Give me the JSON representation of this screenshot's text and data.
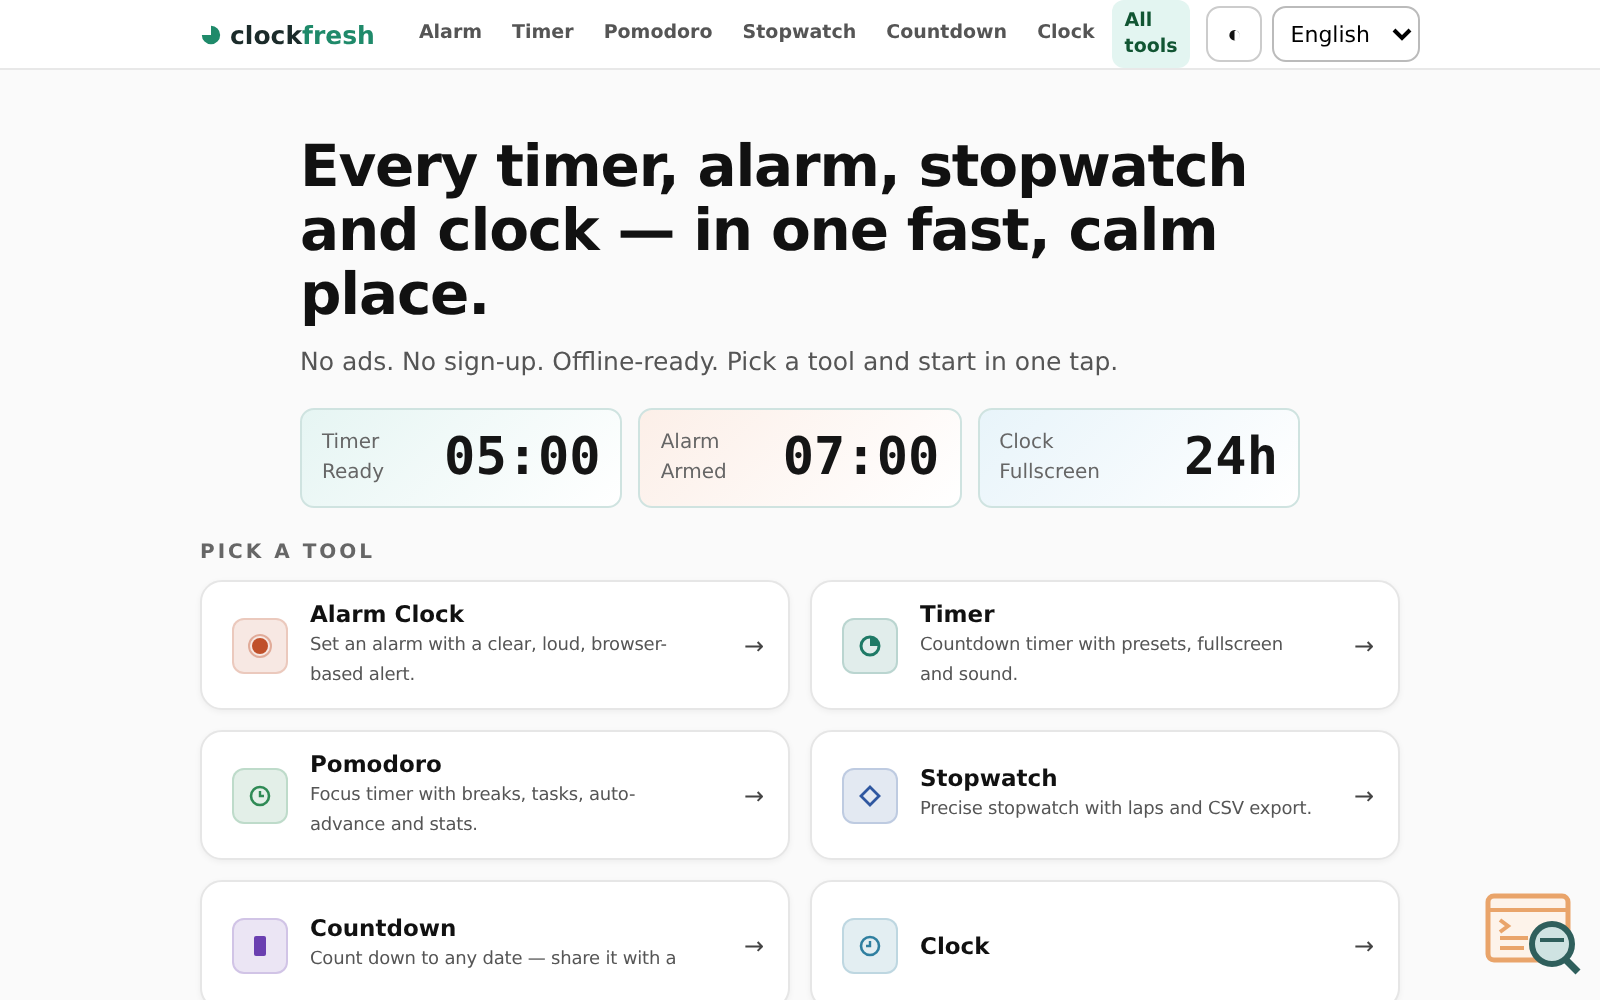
{
  "header": {
    "logo": {
      "brand": "clock",
      "accent": "fresh"
    },
    "nav": [
      {
        "label": "Alarm",
        "selected": false
      },
      {
        "label": "Timer",
        "selected": false
      },
      {
        "label": "Pomodoro",
        "selected": false
      },
      {
        "label": "Stopwatch",
        "selected": false
      },
      {
        "label": "Countdown",
        "selected": false
      },
      {
        "label": "Clock",
        "selected": false
      },
      {
        "label": "All tools",
        "selected": true
      }
    ],
    "theme_toggle": "◐",
    "language": {
      "value": "English"
    }
  },
  "hero": {
    "headline": "Every timer, alarm, stopwatch and clock — in one fast, calm place.",
    "subtitle": "No ads. No sign-up. Offline-ready. Pick a tool and start in one tap.",
    "stats": [
      {
        "label": "Timer",
        "status": "Ready",
        "value": "05:00",
        "color": "#e6f5f3"
      },
      {
        "label": "Alarm",
        "status": "Armed",
        "value": "07:00",
        "color": "#fcefe8"
      },
      {
        "label": "Clock",
        "status": "Fullscreen",
        "value": "24h",
        "color": "#e8f4fa"
      }
    ]
  },
  "section_title": "PICK A TOOL",
  "tools": [
    {
      "kind": "alarm",
      "title": "Alarm Clock",
      "description": "Set an alarm with a clear, loud, browser-based alert.",
      "arrow": "→",
      "color": "#c0502a"
    },
    {
      "kind": "timer",
      "title": "Timer",
      "description": "Countdown timer with presets, fullscreen and sound.",
      "arrow": "→",
      "color": "#1f7a66"
    },
    {
      "kind": "pomodoro",
      "title": "Pomodoro",
      "description": "Focus timer with breaks, tasks, auto-advance and stats.",
      "arrow": "→",
      "color": "#2f8a55"
    },
    {
      "kind": "stopwatch",
      "title": "Stopwatch",
      "description": "Precise stopwatch with laps and CSV export.",
      "arrow": "→",
      "color": "#2f57a0"
    },
    {
      "kind": "countdown",
      "title": "Countdown",
      "description": "Count down to any date — share it with a",
      "arrow": "→",
      "color": "#6a3fb0"
    },
    {
      "kind": "clock",
      "title": "Clock",
      "arrow": "→",
      "color": "#2f7fa0"
    }
  ]
}
